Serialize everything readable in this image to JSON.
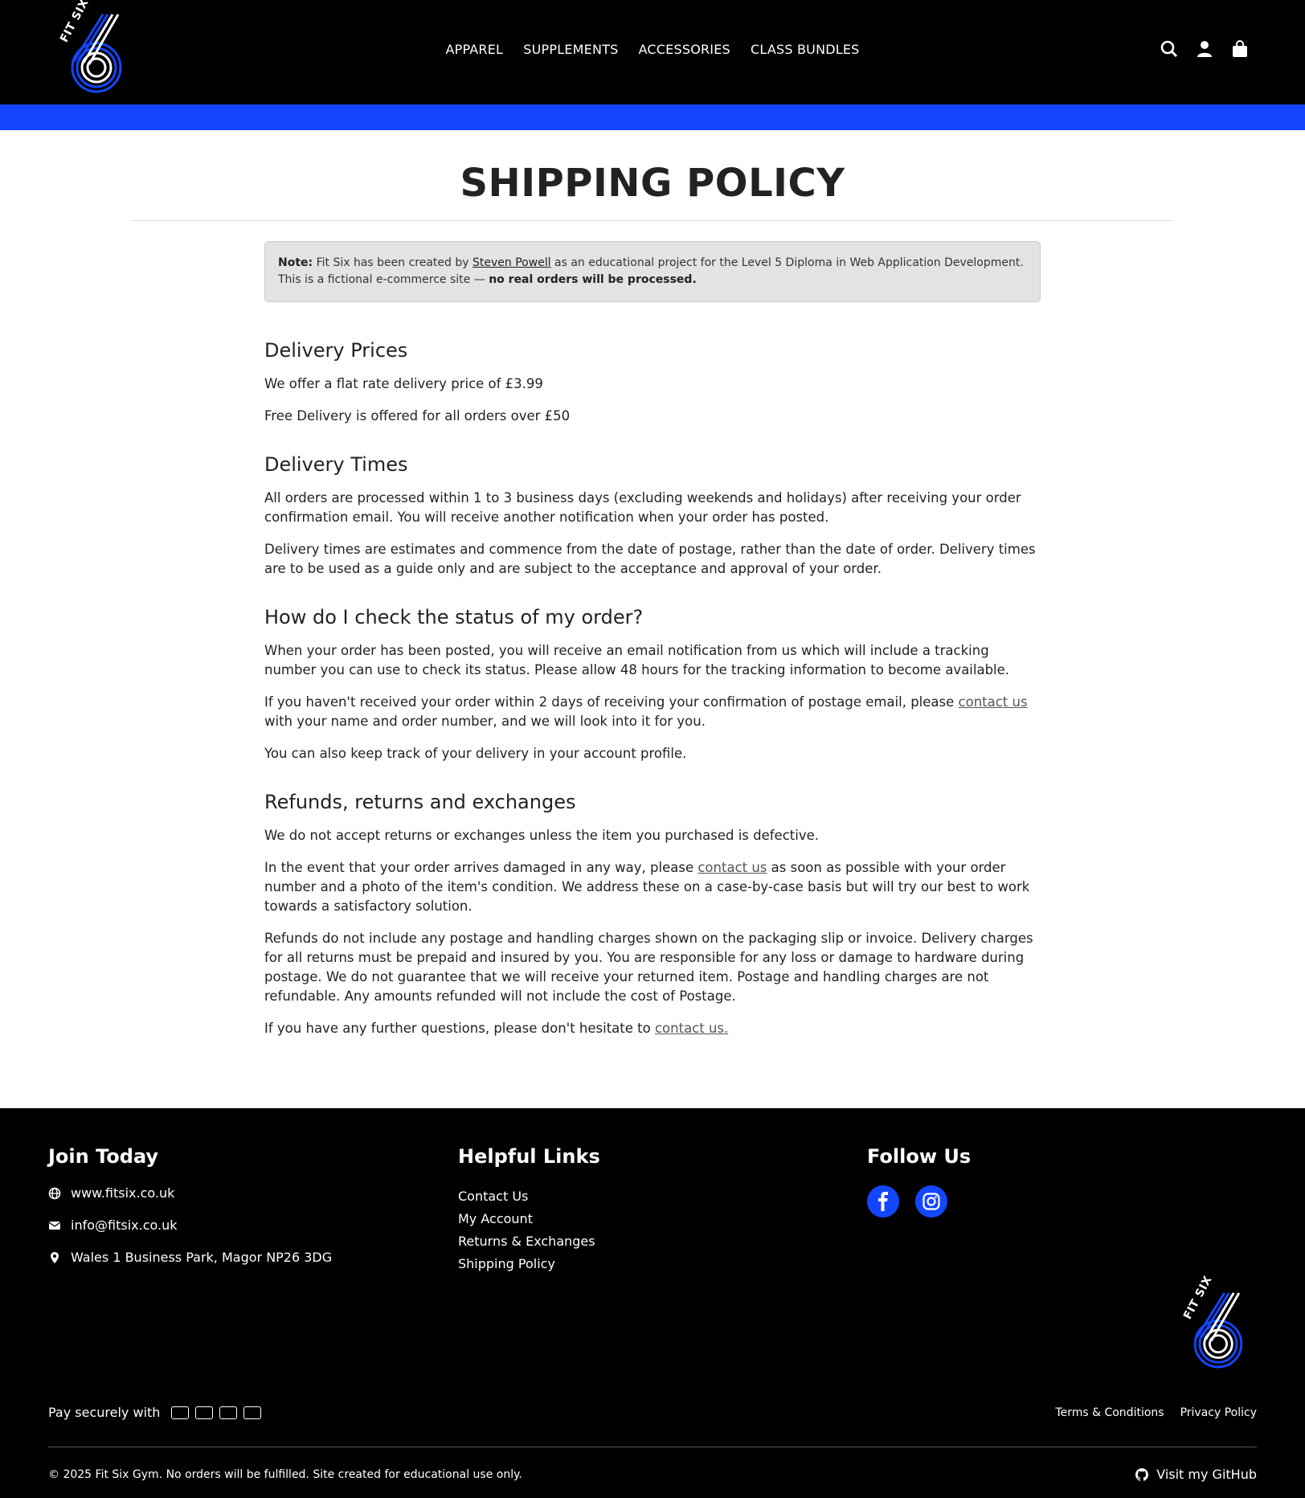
{
  "header": {
    "logo_text": "FIT SIX",
    "nav": [
      "APPAREL",
      "SUPPLEMENTS",
      "ACCESSORIES",
      "CLASS BUNDLES"
    ],
    "icons": [
      "search-icon",
      "account-icon",
      "bag-icon"
    ],
    "accent_color": "#1446ff"
  },
  "main": {
    "title": "SHIPPING POLICY",
    "note": {
      "label": "Note:",
      "text1": "Fit Six has been created by",
      "author": "Steven Powell",
      "text2": "as an educational project for the Level 5 Diploma in Web Application Development.",
      "text3": "This is a fictional e-commerce site —",
      "bold": "no real orders will be processed."
    },
    "sections": {
      "delivery_prices": {
        "heading": "Delivery Prices",
        "p1": "We offer a flat rate delivery price of £3.99",
        "p2": "Free Delivery is offered for all orders over £50"
      },
      "delivery_times": {
        "heading": "Delivery Times",
        "p1": "All orders are processed within 1 to 3 business days (excluding weekends and holidays) after receiving your order confirmation email. You will receive another notification when your order has posted.",
        "p2": "Delivery times are estimates and commence from the date of postage, rather than the date of order. Delivery times are to be used as a guide only and are subject to the acceptance and approval of your order."
      },
      "status": {
        "heading": "How do I check the status of my order?",
        "p1": "When your order has been posted, you will receive an email notification from us which will include a tracking number you can use to check its status. Please allow 48 hours for the tracking information to become available.",
        "p2a": "If you haven't received your order within 2 days of receiving your confirmation of postage email, please",
        "p2link": "contact us",
        "p2b": "with your name and order number, and we will look into it for you.",
        "p3": "You can also keep track of your delivery in your account profile."
      },
      "refunds": {
        "heading": "Refunds, returns and exchanges",
        "p1": "We do not accept returns or exchanges unless the item you purchased is defective.",
        "p2a": "In the event that your order arrives damaged in any way, please",
        "p2link": "contact us",
        "p2b": "as soon as possible with your order number and a photo of the item's condition. We address these on a case-by-case basis but will try our best to work towards a satisfactory solution.",
        "p3": "Refunds do not include any postage and handling charges shown on the packaging slip or invoice. Delivery charges for all returns must be prepaid and insured by you. You are responsible for any loss or damage to hardware during postage. We do not guarantee that we will receive your returned item. Postage and handling charges are not refundable. Any amounts refunded will not include the cost of Postage.",
        "p4a": "If you have any further questions, please don't hesitate to",
        "p4link": "contact us."
      }
    }
  },
  "footer": {
    "join": {
      "heading": "Join Today",
      "website": "www.fitsix.co.uk",
      "email": "info@fitsix.co.uk",
      "address": "Wales 1 Business Park, Magor NP26 3DG"
    },
    "links": {
      "heading": "Helpful Links",
      "items": [
        "Contact Us",
        "My Account",
        "Returns & Exchanges",
        "Shipping Policy"
      ]
    },
    "follow": {
      "heading": "Follow Us",
      "icons": [
        "facebook-icon",
        "instagram-icon"
      ]
    },
    "pay_label": "Pay securely with",
    "card_icons": [
      "visa-icon",
      "mastercard-icon",
      "amex-icon",
      "discover-icon"
    ],
    "legal": [
      "Terms & Conditions",
      "Privacy Policy"
    ],
    "copyright": "© 2025 Fit Six Gym. No orders will be fulfilled. Site created for educational use only.",
    "github": "Visit my GitHub"
  }
}
